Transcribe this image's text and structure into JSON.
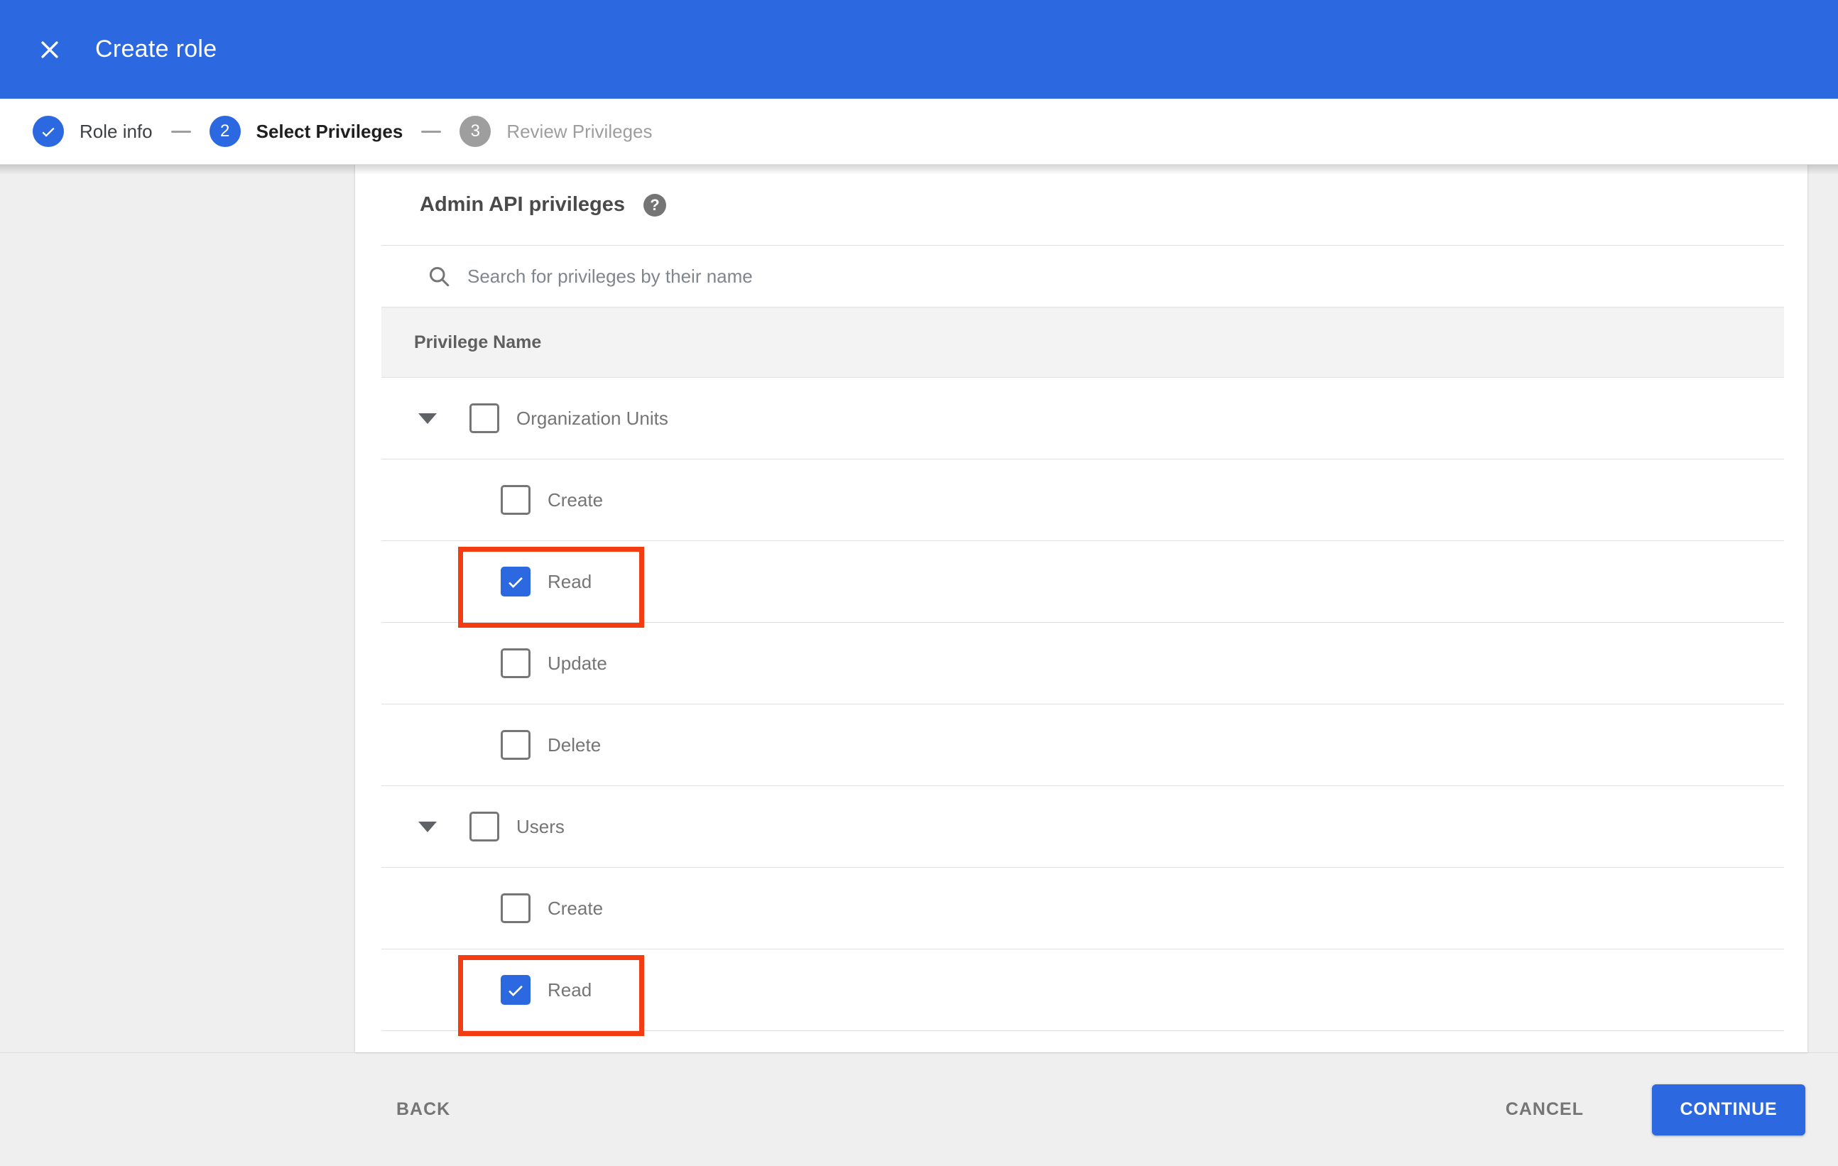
{
  "header": {
    "title": "Create role"
  },
  "stepper": {
    "steps": [
      {
        "label": "Role info",
        "indicator": "check",
        "state": "completed"
      },
      {
        "label": "Select Privileges",
        "indicator": "2",
        "state": "active"
      },
      {
        "label": "Review Privileges",
        "indicator": "3",
        "state": "upcoming"
      }
    ]
  },
  "privileges": {
    "section_title": "Admin API privileges",
    "help_icon": "question-mark",
    "search_placeholder": "Search for privileges by their name",
    "column_header": "Privilege Name",
    "groups": [
      {
        "label": "Organization Units",
        "checked": false,
        "expanded": true,
        "children": [
          {
            "label": "Create",
            "checked": false,
            "highlighted": false
          },
          {
            "label": "Read",
            "checked": true,
            "highlighted": true
          },
          {
            "label": "Update",
            "checked": false,
            "highlighted": false
          },
          {
            "label": "Delete",
            "checked": false,
            "highlighted": false
          }
        ]
      },
      {
        "label": "Users",
        "checked": false,
        "expanded": true,
        "children": [
          {
            "label": "Create",
            "checked": false,
            "highlighted": false
          },
          {
            "label": "Read",
            "checked": true,
            "highlighted": true
          }
        ]
      }
    ]
  },
  "footer": {
    "back": "BACK",
    "cancel": "CANCEL",
    "continue": "CONTINUE"
  },
  "colors": {
    "accent_blue": "#2c68e0",
    "annotation_red": "#f43c12",
    "page_gray": "#efefef",
    "row_border": "#e0e0e0"
  }
}
